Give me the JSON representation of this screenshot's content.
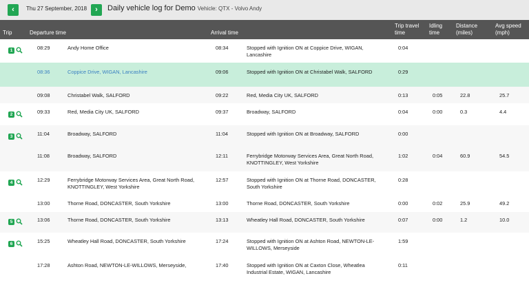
{
  "header": {
    "date": "Thu 27 September, 2018",
    "title": "Daily vehicle log for Demo",
    "vehicle": "Vehicle: QTX - Volvo Andy",
    "prev_icon": "chevron-left-icon",
    "next_icon": "chevron-right-icon"
  },
  "columns": {
    "trip": "Trip",
    "departure": "Departure time",
    "arrival": "Arrival time",
    "travel_l1": "Trip travel",
    "travel_l2": "time",
    "idling_l1": "Idling",
    "idling_l2": "time",
    "distance_l1": "Distance",
    "distance_l2": "(miles)",
    "speed_l1": "Avg speed",
    "speed_l2": "(mph)"
  },
  "colors": {
    "accent": "#21a653",
    "header_bg": "#555555",
    "selected_row": "#c8eedb",
    "link": "#3a7fc1"
  },
  "rows": [
    {
      "trip": "1",
      "dep_time": "08:29",
      "dep_place": "Andy Home Office",
      "arr_time": "08:34",
      "arr_place": "Stopped with Ignition ON at Coppice Drive, WIGAN, Lancashire",
      "travel": "0:04",
      "idling": "",
      "distance": "",
      "speed": ""
    },
    {
      "trip": "",
      "dep_time": "08:36",
      "dep_place": "Coppice Drive, WIGAN, Lancashire",
      "arr_time": "09:06",
      "arr_place": "Stopped with Ignition ON at Christabel Walk, SALFORD",
      "travel": "0:29",
      "idling": "",
      "distance": "",
      "speed": ""
    },
    {
      "trip": "",
      "dep_time": "09:08",
      "dep_place": "Christabel Walk, SALFORD",
      "arr_time": "09:22",
      "arr_place": "Red, Media City UK, SALFORD",
      "travel": "0:13",
      "idling": "0:05",
      "distance": "22.8",
      "speed": "25.7"
    },
    {
      "trip": "2",
      "dep_time": "09:33",
      "dep_place": "Red, Media City UK, SALFORD",
      "arr_time": "09:37",
      "arr_place": "Broadway, SALFORD",
      "travel": "0:04",
      "idling": "0:00",
      "distance": "0.3",
      "speed": "4.4"
    },
    {
      "trip": "3",
      "dep_time": "11:04",
      "dep_place": "Broadway, SALFORD",
      "arr_time": "11:04",
      "arr_place": "Stopped with Ignition ON at Broadway, SALFORD",
      "travel": "0:00",
      "idling": "",
      "distance": "",
      "speed": ""
    },
    {
      "trip": "",
      "dep_time": "11:08",
      "dep_place": "Broadway, SALFORD",
      "arr_time": "12:11",
      "arr_place": "Ferrybridge Motorway Services Area, Great North Road, KNOTTINGLEY, West Yorkshire",
      "travel": "1:02",
      "idling": "0:04",
      "distance": "60.9",
      "speed": "54.5"
    },
    {
      "trip": "4",
      "dep_time": "12:29",
      "dep_place": "Ferrybridge Motorway Services Area, Great North Road, KNOTTINGLEY, West Yorkshire",
      "arr_time": "12:57",
      "arr_place": "Stopped with Ignition ON at Thorne Road, DONCASTER, South Yorkshire",
      "travel": "0:28",
      "idling": "",
      "distance": "",
      "speed": ""
    },
    {
      "trip": "",
      "dep_time": "13:00",
      "dep_place": "Thorne Road, DONCASTER, South Yorkshire",
      "arr_time": "13:00",
      "arr_place": "Thorne Road, DONCASTER, South Yorkshire",
      "travel": "0:00",
      "idling": "0:02",
      "distance": "25.9",
      "speed": "49.2"
    },
    {
      "trip": "5",
      "dep_time": "13:06",
      "dep_place": "Thorne Road, DONCASTER, South Yorkshire",
      "arr_time": "13:13",
      "arr_place": "Wheatley Hall Road, DONCASTER, South Yorkshire",
      "travel": "0:07",
      "idling": "0:00",
      "distance": "1.2",
      "speed": "10.0"
    },
    {
      "trip": "6",
      "dep_time": "15:25",
      "dep_place": "Wheatley Hall Road, DONCASTER, South Yorkshire",
      "arr_time": "17:24",
      "arr_place": "Stopped with Ignition ON at Ashton Road, NEWTON-LE-WILLOWS, Merseyside",
      "travel": "1:59",
      "idling": "",
      "distance": "",
      "speed": ""
    },
    {
      "trip": "",
      "dep_time": "17:28",
      "dep_place": "Ashton Road, NEWTON-LE-WILLOWS, Merseyside,",
      "arr_time": "17:40",
      "arr_place": "Stopped with Ignition ON at Caxton Close, Wheatlea Industrial Estate, WIGAN, Lancashire",
      "travel": "0:11",
      "idling": "",
      "distance": "",
      "speed": ""
    }
  ]
}
